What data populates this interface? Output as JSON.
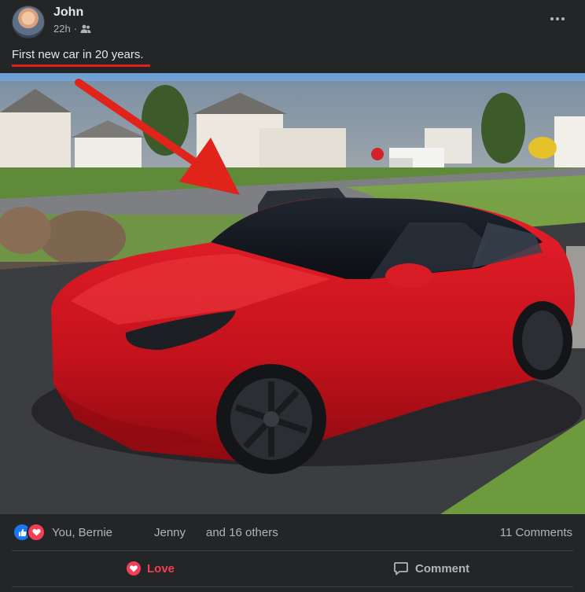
{
  "post": {
    "author": "John",
    "time": "22h",
    "separator": "·",
    "audience_icon": "friends-icon",
    "caption": "First new car in 20 years."
  },
  "reactions": {
    "icons": [
      "like-icon",
      "love-icon"
    ],
    "names_1": "You, Bernie",
    "names_2": "Jenny",
    "names_3": "and 16 others",
    "comments": "11 Comments"
  },
  "actions": {
    "love_label": "Love",
    "comment_label": "Comment"
  },
  "colors": {
    "background": "#242526",
    "annotation_red": "#e0241b",
    "love": "#f33e58",
    "like": "#1877f2"
  }
}
